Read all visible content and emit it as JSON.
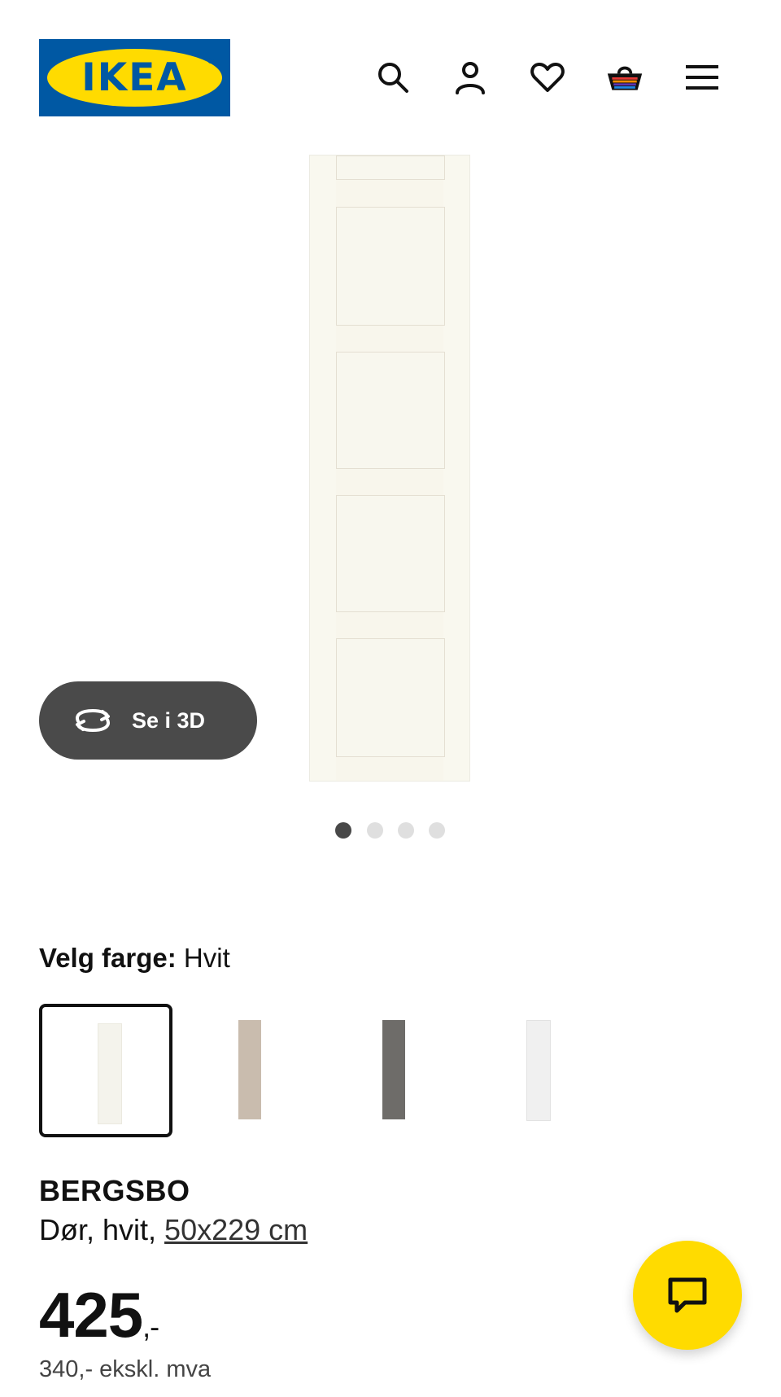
{
  "header": {
    "logo_text": "IKEA",
    "logo_registered": "®",
    "icons": [
      "search-icon",
      "user-icon",
      "heart-icon",
      "basket-icon",
      "menu-icon"
    ]
  },
  "gallery": {
    "view_3d_label": "Se i 3D",
    "image_count": 4,
    "active_index": 0
  },
  "color_picker": {
    "label": "Velg farge:",
    "selected_value": "Hvit",
    "swatch_colors": [
      "#f4f3ec",
      "#c9bcae",
      "#6e6c69",
      "#f0f0f0"
    ],
    "selected_index": 0
  },
  "product": {
    "name": "BERGSBO",
    "description": "Dør, hvit,",
    "size": "50x229 cm",
    "price_main": "425",
    "price_suffix": ",-",
    "price_ex_vat": "340,- ekskl. mva"
  },
  "colors": {
    "brand_blue": "#0058A3",
    "brand_yellow": "#FFDB00",
    "dark_button": "#4a4a4a"
  }
}
